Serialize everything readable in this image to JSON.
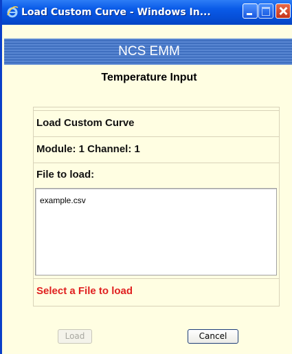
{
  "window": {
    "title": "Load Custom Curve - Windows In...",
    "icon": "ie-icon"
  },
  "banner": {
    "title": "NCS EMM"
  },
  "page": {
    "subtitle": "Temperature Input"
  },
  "form": {
    "heading": "Load Custom Curve",
    "module_channel": "Module: 1 Channel: 1",
    "file_label": "File to load:",
    "file_value": "example.csv",
    "status": "Select a File to load",
    "status_color": "#e02020"
  },
  "buttons": {
    "load": "Load",
    "cancel": "Cancel"
  },
  "colors": {
    "titlebar": "#0a5be8",
    "banner": "#4678c8",
    "background": "#fffee2"
  }
}
